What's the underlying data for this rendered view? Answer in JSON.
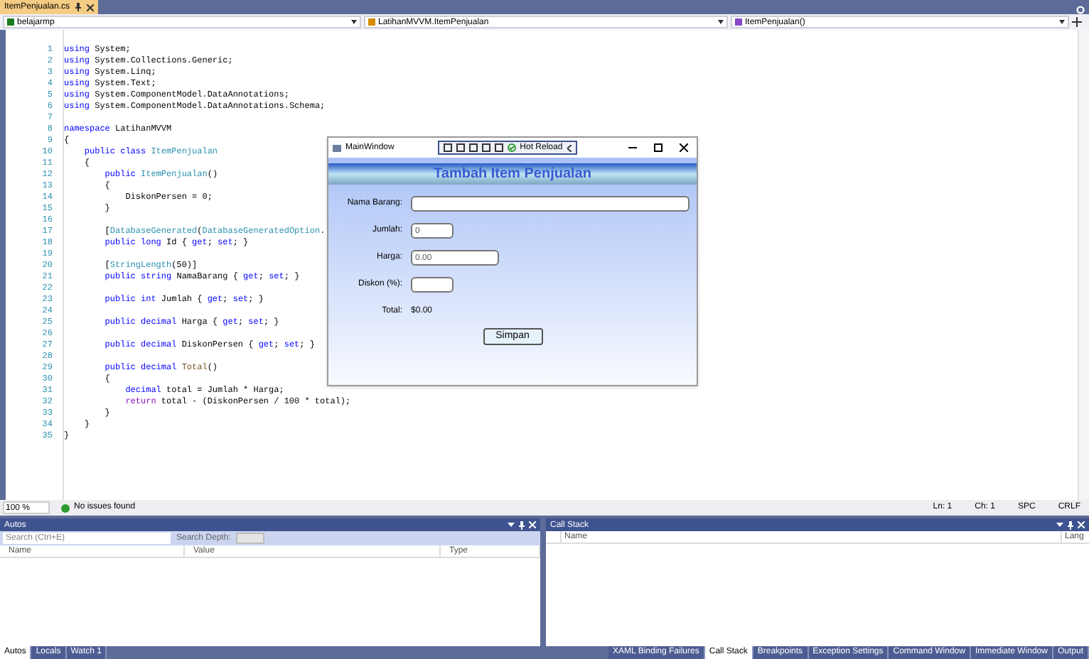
{
  "document_tab": {
    "label": "ItemPenjualan.cs",
    "selected": true
  },
  "nav_bar": {
    "project": "belajarmp",
    "type": "LatihanMVVM.ItemPenjualan",
    "member": "ItemPenjualan()"
  },
  "code_lines": [
    {
      "number": "1",
      "tokens": [
        {
          "kind": "keyword",
          "text": "using"
        },
        {
          "kind": "plain",
          "text": " System;"
        }
      ]
    },
    {
      "number": "2",
      "tokens": [
        {
          "kind": "keyword",
          "text": "using"
        },
        {
          "kind": "plain",
          "text": " System.Collections.Generic;"
        }
      ]
    },
    {
      "number": "3",
      "tokens": [
        {
          "kind": "keyword",
          "text": "using"
        },
        {
          "kind": "plain",
          "text": " System.Linq;"
        }
      ]
    },
    {
      "number": "4",
      "tokens": [
        {
          "kind": "keyword",
          "text": "using"
        },
        {
          "kind": "plain",
          "text": " System.Text;"
        }
      ]
    },
    {
      "number": "5",
      "tokens": [
        {
          "kind": "keyword",
          "text": "using"
        },
        {
          "kind": "plain",
          "text": " System.ComponentModel.DataAnnotations;"
        }
      ]
    },
    {
      "number": "6",
      "tokens": [
        {
          "kind": "keyword",
          "text": "using"
        },
        {
          "kind": "plain",
          "text": " System.ComponentModel.DataAnnotations.Schema;"
        }
      ]
    },
    {
      "number": "7"
    },
    {
      "number": "8",
      "tokens": [
        {
          "kind": "keyword",
          "text": "namespace"
        },
        {
          "kind": "plain",
          "text": " LatihanMVVM"
        }
      ]
    },
    {
      "number": "9",
      "tokens": [
        {
          "kind": "plain",
          "text": "{"
        }
      ]
    },
    {
      "number": "10",
      "tokens": [
        {
          "kind": "keyword",
          "text": "    public class"
        },
        {
          "kind": "type",
          "text": " ItemPenjualan"
        }
      ]
    },
    {
      "number": "11",
      "tokens": [
        {
          "kind": "plain",
          "text": "    {"
        }
      ]
    },
    {
      "number": "12",
      "tokens": [
        {
          "kind": "keyword",
          "text": "        public"
        },
        {
          "kind": "type",
          "text": " ItemPenjualan"
        },
        {
          "kind": "plain",
          "text": "()"
        }
      ]
    },
    {
      "number": "13",
      "tokens": [
        {
          "kind": "plain",
          "text": "        {"
        }
      ]
    },
    {
      "number": "14",
      "tokens": [
        {
          "kind": "plain",
          "text": "            DiskonPersen = 0;"
        }
      ]
    },
    {
      "number": "15",
      "tokens": [
        {
          "kind": "plain",
          "text": "        }"
        }
      ]
    },
    {
      "number": "16"
    },
    {
      "number": "17",
      "tokens": [
        {
          "kind": "plain",
          "text": "        ["
        },
        {
          "kind": "type",
          "text": "DatabaseGenerated"
        },
        {
          "kind": "plain",
          "text": "("
        },
        {
          "kind": "type",
          "text": "DatabaseGeneratedOption"
        },
        {
          "kind": "plain",
          "text": "."
        }
      ]
    },
    {
      "number": "18",
      "tokens": [
        {
          "kind": "keyword",
          "text": "        public long"
        },
        {
          "kind": "plain",
          "text": " Id { "
        },
        {
          "kind": "keyword",
          "text": "get"
        },
        {
          "kind": "plain",
          "text": "; "
        },
        {
          "kind": "keyword",
          "text": "set"
        },
        {
          "kind": "plain",
          "text": "; }"
        }
      ]
    },
    {
      "number": "19"
    },
    {
      "number": "20",
      "tokens": [
        {
          "kind": "plain",
          "text": "        ["
        },
        {
          "kind": "type",
          "text": "StringLength"
        },
        {
          "kind": "plain",
          "text": "(50)]"
        }
      ]
    },
    {
      "number": "21",
      "tokens": [
        {
          "kind": "keyword",
          "text": "        public string"
        },
        {
          "kind": "plain",
          "text": " NamaBarang { "
        },
        {
          "kind": "keyword",
          "text": "get"
        },
        {
          "kind": "plain",
          "text": "; "
        },
        {
          "kind": "keyword",
          "text": "set"
        },
        {
          "kind": "plain",
          "text": "; }"
        }
      ]
    },
    {
      "number": "22"
    },
    {
      "number": "23",
      "tokens": [
        {
          "kind": "keyword",
          "text": "        public int"
        },
        {
          "kind": "plain",
          "text": " Jumlah { "
        },
        {
          "kind": "keyword",
          "text": "get"
        },
        {
          "kind": "plain",
          "text": "; "
        },
        {
          "kind": "keyword",
          "text": "set"
        },
        {
          "kind": "plain",
          "text": "; }"
        }
      ]
    },
    {
      "number": "24"
    },
    {
      "number": "25",
      "tokens": [
        {
          "kind": "keyword",
          "text": "        public decimal"
        },
        {
          "kind": "plain",
          "text": " Harga { "
        },
        {
          "kind": "keyword",
          "text": "get"
        },
        {
          "kind": "plain",
          "text": "; "
        },
        {
          "kind": "keyword",
          "text": "set"
        },
        {
          "kind": "plain",
          "text": "; }"
        }
      ]
    },
    {
      "number": "26"
    },
    {
      "number": "27",
      "tokens": [
        {
          "kind": "keyword",
          "text": "        public decimal"
        },
        {
          "kind": "plain",
          "text": " DiskonPersen { "
        },
        {
          "kind": "keyword",
          "text": "get"
        },
        {
          "kind": "plain",
          "text": "; "
        },
        {
          "kind": "keyword",
          "text": "set"
        },
        {
          "kind": "plain",
          "text": "; }"
        }
      ]
    },
    {
      "number": "28"
    },
    {
      "number": "29",
      "tokens": [
        {
          "kind": "keyword",
          "text": "        public decimal"
        },
        {
          "kind": "method",
          "text": " Total"
        },
        {
          "kind": "plain",
          "text": "()"
        }
      ]
    },
    {
      "number": "30",
      "tokens": [
        {
          "kind": "plain",
          "text": "        {"
        }
      ]
    },
    {
      "number": "31",
      "tokens": [
        {
          "kind": "keyword",
          "text": "            decimal"
        },
        {
          "kind": "plain",
          "text": " total = Jumlah * Harga;"
        }
      ]
    },
    {
      "number": "32",
      "tokens": [
        {
          "kind": "control",
          "text": "            return"
        },
        {
          "kind": "plain",
          "text": " total - (DiskonPersen / 100 * total);"
        }
      ]
    },
    {
      "number": "33",
      "tokens": [
        {
          "kind": "plain",
          "text": "        }"
        }
      ]
    },
    {
      "number": "34",
      "tokens": [
        {
          "kind": "plain",
          "text": "    }"
        }
      ]
    },
    {
      "number": "35",
      "tokens": [
        {
          "kind": "plain",
          "text": "}"
        }
      ]
    }
  ],
  "app_window": {
    "title": "MainWindow",
    "hot_reload": "Hot Reload",
    "header": "Tambah Item Penjualan",
    "fields": [
      {
        "kind": "input",
        "label": "Nama Barang:"
      },
      {
        "kind": "input",
        "label": "Jumlah:",
        "value": "0"
      },
      {
        "kind": "input",
        "label": "Harga:",
        "value": "0.00"
      },
      {
        "kind": "input",
        "label": "Diskon (%):"
      },
      {
        "kind": "text",
        "label": "Total:",
        "value": "$0.00"
      }
    ],
    "button": "Simpan"
  },
  "status_bar": {
    "zoom": "100 %",
    "issues": "No issues found",
    "line": "Ln: 1",
    "char": "Ch: 1",
    "spacing": "SPC",
    "ending": "CRLF"
  },
  "autos_panel": {
    "title": "Autos",
    "search_placeholder": "Search (Ctrl+E)",
    "search_depth": "Search Depth:",
    "columns": [
      "Name",
      "Value",
      "Type"
    ]
  },
  "call_stack_panel": {
    "title": "Call Stack",
    "columns": [
      "Name",
      "Lang"
    ]
  },
  "left_tabs": [
    {
      "label": "Autos",
      "selected": true
    },
    {
      "label": "Locals",
      "selected": false
    },
    {
      "label": "Watch 1",
      "selected": false
    }
  ],
  "right_tabs": [
    {
      "label": "XAML Binding Failures",
      "selected": false
    },
    {
      "label": "Call Stack",
      "selected": true
    },
    {
      "label": "Breakpoints",
      "selected": false
    },
    {
      "label": "Exception Settings",
      "selected": false
    },
    {
      "label": "Command Window",
      "selected": false
    },
    {
      "label": "Immediate Window",
      "selected": false
    },
    {
      "label": "Output",
      "selected": false
    }
  ]
}
